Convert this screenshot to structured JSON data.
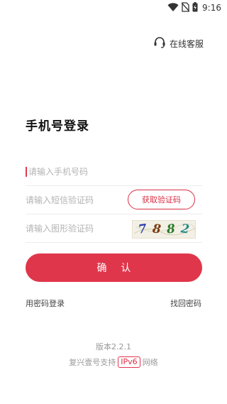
{
  "status_bar": {
    "time": "9:16",
    "icons": [
      "wifi-icon",
      "no-sim-icon",
      "battery-charging-icon"
    ]
  },
  "header": {
    "service_label": "在线客服",
    "service_icon": "headset-icon"
  },
  "page_title": "手机号登录",
  "form": {
    "phone_placeholder": "请输入手机号码",
    "sms_placeholder": "请输入短信验证码",
    "sms_button_label": "获取验证码",
    "captcha_placeholder": "请输入图形验证码",
    "captcha_chars": [
      "7",
      "8",
      "8",
      "2"
    ],
    "confirm_label": "确 认"
  },
  "links": {
    "password_login": "用密码登录",
    "recover_password": "找回密码"
  },
  "footer": {
    "version": "版本2.2.1",
    "network_prefix": "复兴壹号支持",
    "network_badge": "IPv6",
    "network_suffix": "网络"
  },
  "colors": {
    "accent": "#e0364b",
    "placeholder": "#b3b3b3",
    "footer_text": "#999999"
  }
}
